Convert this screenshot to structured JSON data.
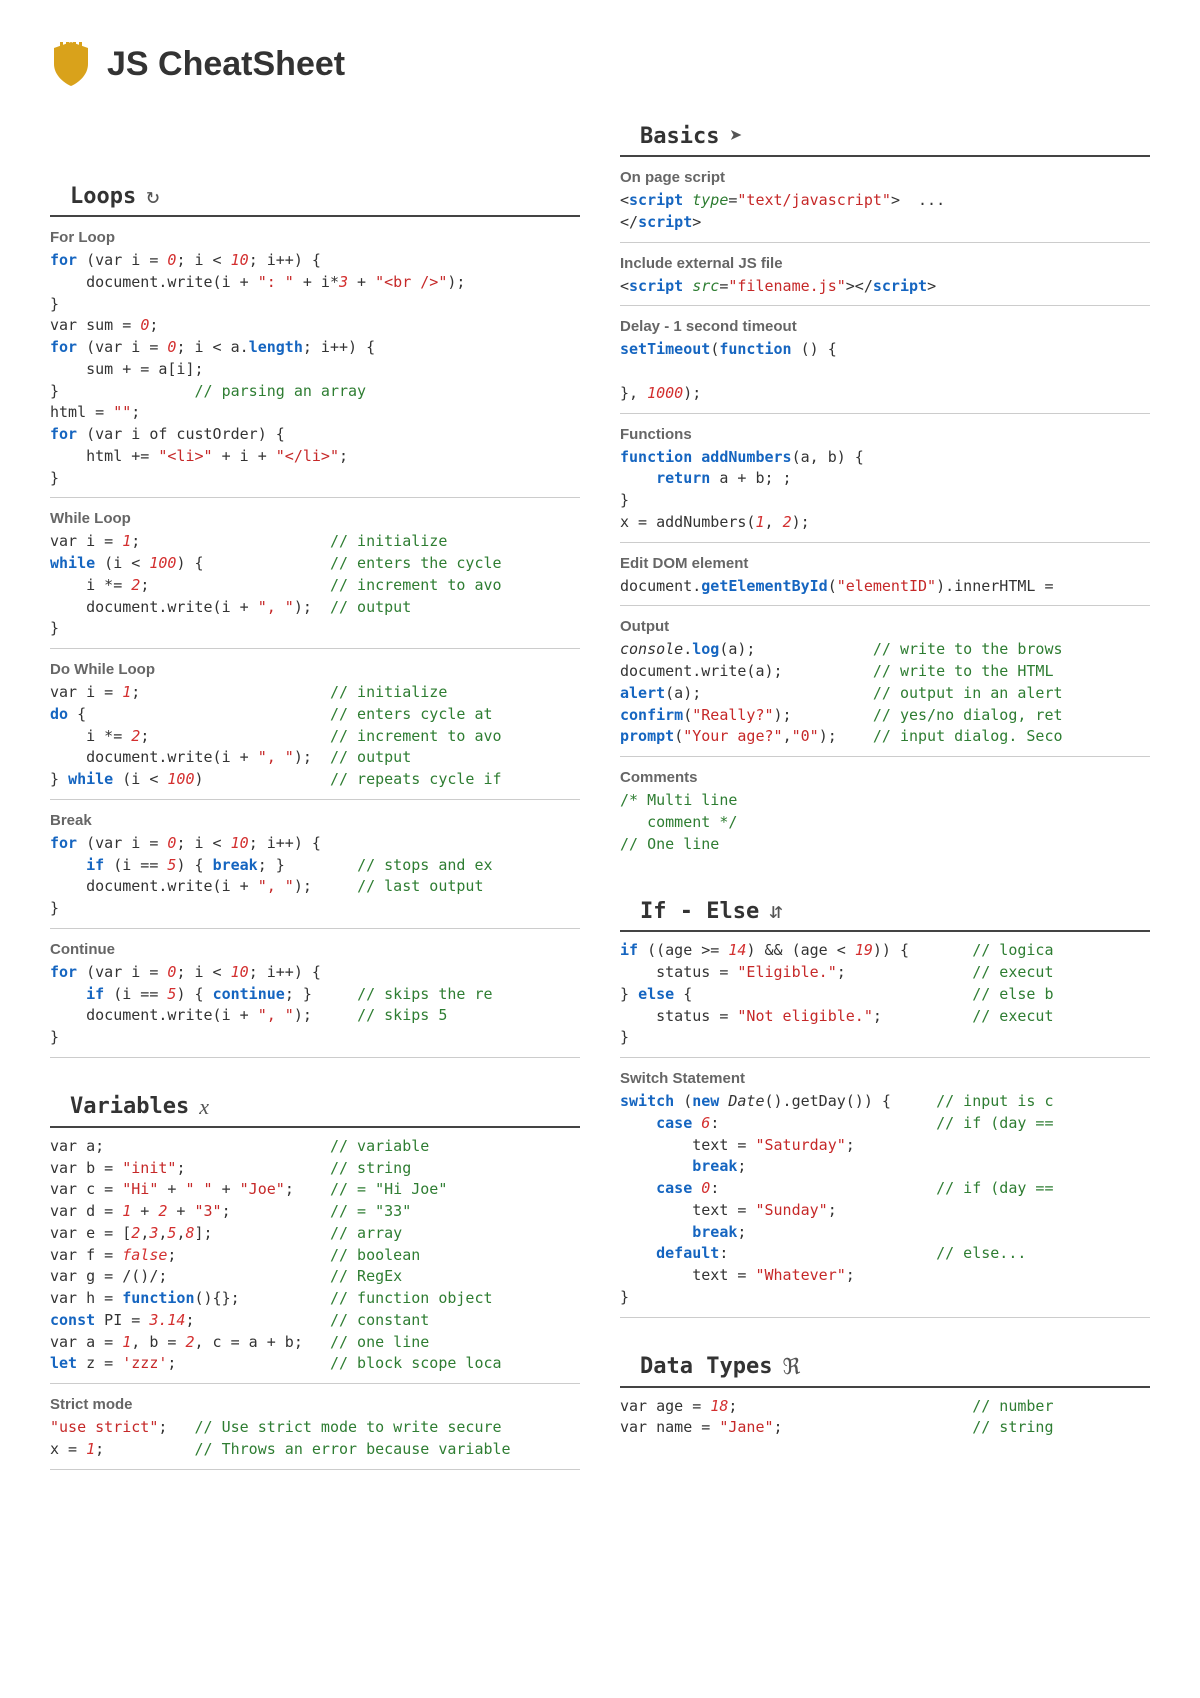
{
  "page": {
    "title": "JS CheatSheet"
  },
  "sections": {
    "loops": {
      "title": "Loops",
      "blocks": {
        "for": {
          "label": "For Loop",
          "code": "<span class='kw'>for</span> (var i = <span class='num'>0</span>; i &lt; <span class='num'>10</span>; i++) {\n    document.write(i + <span class='str'>\": \"</span> + i*<span class='num'>3</span> + <span class='str'>\"&lt;br /&gt;\"</span>);\n}\nvar sum = <span class='num'>0</span>;\n<span class='kw'>for</span> (var i = <span class='num'>0</span>; i &lt; a.<span class='kw'>length</span>; i++) {\n    sum + = a[i];\n}               <span class='com'>// parsing an array</span>\nhtml = <span class='str'>\"\"</span>;\n<span class='kw'>for</span> (var i of custOrder) {\n    html += <span class='str'>\"&lt;li&gt;\"</span> + i + <span class='str'>\"&lt;/li&gt;\"</span>;\n}"
        },
        "while": {
          "label": "While Loop",
          "code": "var i = <span class='num'>1</span>;                     <span class='com'>// initialize</span>\n<span class='kw'>while</span> (i &lt; <span class='num'>100</span>) {              <span class='com'>// enters the cycle</span>\n    i *= <span class='num'>2</span>;                    <span class='com'>// increment to avo</span>\n    document.write(i + <span class='str'>\", \"</span>);  <span class='com'>// output</span>\n}"
        },
        "dowhile": {
          "label": "Do While Loop",
          "code": "var i = <span class='num'>1</span>;                     <span class='com'>// initialize</span>\n<span class='kw'>do</span> {                           <span class='com'>// enters cycle at</span>\n    i *= <span class='num'>2</span>;                    <span class='com'>// increment to avo</span>\n    document.write(i + <span class='str'>\", \"</span>);  <span class='com'>// output</span>\n} <span class='kw'>while</span> (i &lt; <span class='num'>100</span>)              <span class='com'>// repeats cycle if</span>"
        },
        "break": {
          "label": "Break",
          "code": "<span class='kw'>for</span> (var i = <span class='num'>0</span>; i &lt; <span class='num'>10</span>; i++) {\n    <span class='kw'>if</span> (i == <span class='num'>5</span>) { <span class='kw'>break</span>; }        <span class='com'>// stops and ex</span>\n    document.write(i + <span class='str'>\", \"</span>);     <span class='com'>// last output </span>\n}"
        },
        "continue": {
          "label": "Continue",
          "code": "<span class='kw'>for</span> (var i = <span class='num'>0</span>; i &lt; <span class='num'>10</span>; i++) {\n    <span class='kw'>if</span> (i == <span class='num'>5</span>) { <span class='kw'>continue</span>; }     <span class='com'>// skips the re</span>\n    document.write(i + <span class='str'>\", \"</span>);     <span class='com'>// skips 5</span>\n}"
        }
      }
    },
    "variables": {
      "title": "Variables",
      "blocks": {
        "main": {
          "code": "var a;                         <span class='com'>// variable</span>\nvar b = <span class='str'>\"init\"</span>;                <span class='com'>// string</span>\nvar c = <span class='str'>\"Hi\"</span> + <span class='str'>\" \"</span> + <span class='str'>\"Joe\"</span>;    <span class='com'>// = \"Hi Joe\"</span>\nvar d = <span class='num'>1</span> + <span class='num'>2</span> + <span class='str'>\"3\"</span>;           <span class='com'>// = \"33\"</span>\nvar e = [<span class='num'>2</span>,<span class='num'>3</span>,<span class='num'>5</span>,<span class='num'>8</span>];             <span class='com'>// array</span>\nvar f = <span class='num'>false</span>;                 <span class='com'>// boolean</span>\nvar g = /()/;                  <span class='com'>// RegEx</span>\nvar h = <span class='kw'>function</span>(){};          <span class='com'>// function object</span>\n<span class='kw'>const</span> PI = <span class='num'>3.14</span>;               <span class='com'>// constant</span>\nvar a = <span class='num'>1</span>, b = <span class='num'>2</span>, c = a + b;   <span class='com'>// one line</span>\n<span class='kw'>let</span> z = <span class='str'>'zzz'</span>;                 <span class='com'>// block scope loca</span>"
        },
        "strict": {
          "label": "Strict mode",
          "code": "<span class='str'>\"use strict\"</span>;   <span class='com'>// Use strict mode to write secure</span>\nx = <span class='num'>1</span>;          <span class='com'>// Throws an error because variable</span>"
        }
      }
    },
    "basics": {
      "title": "Basics",
      "blocks": {
        "onpage": {
          "label": "On page script",
          "code": "&lt;<span class='kw'>script</span> <span class='attr'>type</span>=<span class='tp'>\"text/javascript\"</span>&gt;  ...\n&lt;/<span class='kw'>script</span>&gt;"
        },
        "external": {
          "label": "Include external JS file",
          "code": "&lt;<span class='kw'>script</span> <span class='attr'>src</span>=<span class='tp'>\"filename.js\"</span>&gt;&lt;/<span class='kw'>script</span>&gt;"
        },
        "delay": {
          "label": "Delay - 1 second timeout",
          "code": "<span class='fn'>setTimeout</span>(<span class='kw'>function</span> () {\n\n}, <span class='num'>1000</span>);"
        },
        "functions": {
          "label": "Functions",
          "code": "<span class='kw'>function</span> <span class='fn'>addNumbers</span>(a, b) {\n    <span class='kw'>return</span> a + b; ;\n}\nx = addNumbers(<span class='num'>1</span>, <span class='num'>2</span>);"
        },
        "dom": {
          "label": "Edit DOM element",
          "code": "document.<span class='fn'>getElementById</span>(<span class='str'>\"elementID\"</span>).innerHTML = "
        },
        "output": {
          "label": "Output",
          "code": "<span class='obj'>console</span>.<span class='fn'>log</span>(a);             <span class='com'>// write to the brows</span>\ndocument.write(a);          <span class='com'>// write to the HTML</span>\n<span class='fn'>alert</span>(a);                   <span class='com'>// output in an alert</span>\n<span class='fn'>confirm</span>(<span class='str'>\"Really?\"</span>);         <span class='com'>// yes/no dialog, ret</span>\n<span class='fn'>prompt</span>(<span class='str'>\"Your age?\"</span>,<span class='str'>\"0\"</span>);    <span class='com'>// input dialog. Seco</span>"
        },
        "comments": {
          "label": "Comments",
          "code": "<span class='com'>/* Multi line\n   comment */</span>\n<span class='com'>// One line</span>"
        }
      }
    },
    "ifelse": {
      "title": "If - Else",
      "blocks": {
        "main": {
          "code": "<span class='kw'>if</span> ((age &gt;= <span class='num'>14</span>) &amp;&amp; (age &lt; <span class='num'>19</span>)) {       <span class='com'>// logica</span>\n    status = <span class='str'>\"Eligible.\"</span>;              <span class='com'>// execut</span>\n} <span class='kw'>else</span> {                               <span class='com'>// else b</span>\n    status = <span class='str'>\"Not eligible.\"</span>;          <span class='com'>// execut</span>\n}"
        },
        "switch": {
          "label": "Switch Statement",
          "code": "<span class='kw'>switch</span> (<span class='kw'>new</span> <span class='obj'>Date</span>().getDay()) {     <span class='com'>// input is c</span>\n    <span class='kw'>case</span> <span class='num'>6</span>:                        <span class='com'>// if (day ==</span>\n        text = <span class='str'>\"Saturday\"</span>;\n        <span class='kw'>break</span>;\n    <span class='kw'>case</span> <span class='num'>0</span>:                        <span class='com'>// if (day ==</span>\n        text = <span class='str'>\"Sunday\"</span>;\n        <span class='kw'>break</span>;\n    <span class='kw'>default</span>:                       <span class='com'>// else...</span>\n        text = <span class='str'>\"Whatever\"</span>;\n}"
        }
      }
    },
    "datatypes": {
      "title": "Data Types",
      "blocks": {
        "main": {
          "code": "var age = <span class='num'>18</span>;                          <span class='com'>// number</span>\nvar name = <span class='str'>\"Jane\"</span>;                     <span class='com'>// string</span>"
        }
      }
    }
  }
}
